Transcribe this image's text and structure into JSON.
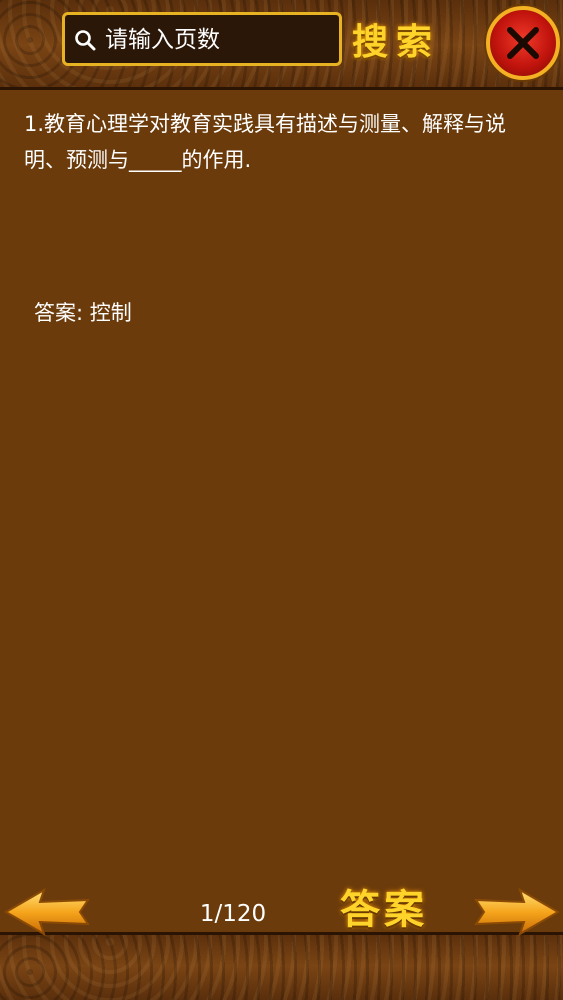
{
  "search": {
    "placeholder": "请输入页数",
    "button_label": "搜索"
  },
  "question": {
    "text": "1.教育心理学对教育实践具有描述与测量、解释与说明、预测与_____的作用."
  },
  "answer": {
    "text": "答案: 控制"
  },
  "navigation": {
    "page_indicator": "1/120",
    "answer_button_label": "答案"
  },
  "icons": {
    "search": "search-icon",
    "close": "close-icon",
    "prev": "arrow-left-icon",
    "next": "arrow-right-icon"
  },
  "colors": {
    "background": "#6b3b0b",
    "accent_gold": "#ffd42a",
    "border_gold": "#e8b323",
    "close_red": "#c1140d"
  }
}
